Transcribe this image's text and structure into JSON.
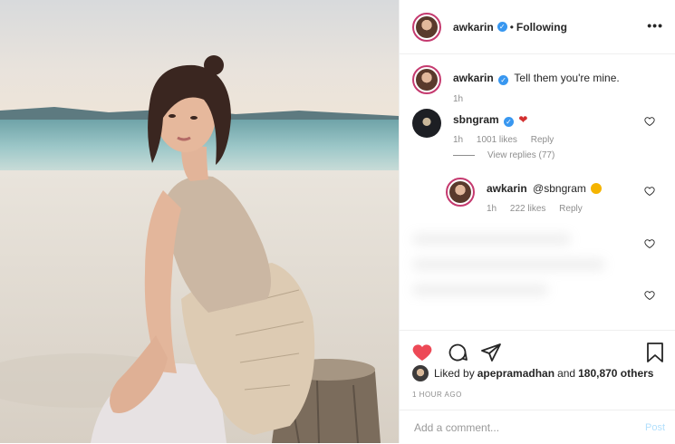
{
  "post": {
    "author": "awkarin",
    "follow_status": "Following",
    "more_label": "•••",
    "caption": "Tell them you're mine.",
    "caption_age": "1h"
  },
  "comments": [
    {
      "username": "sbngram",
      "text": "",
      "emoji": "red-heart",
      "age": "1h",
      "likes": "1001 likes",
      "reply_label": "Reply",
      "view_replies": "View replies (77)"
    },
    {
      "username": "awkarin",
      "text": "@sbngram",
      "emoji": "smiling-face",
      "age": "1h",
      "likes": "222 likes",
      "reply_label": "Reply"
    }
  ],
  "actions": {
    "like_color": "#ed4956",
    "icons": [
      "heart-icon",
      "comment-icon",
      "share-icon",
      "save-icon"
    ]
  },
  "liked_by": {
    "prefix": "Liked by",
    "user": "apepramadhan",
    "middle": "and",
    "count": "180,870 others"
  },
  "timestamp": "1 HOUR AGO",
  "add_comment": {
    "placeholder": "Add a comment...",
    "post_label": "Post"
  }
}
